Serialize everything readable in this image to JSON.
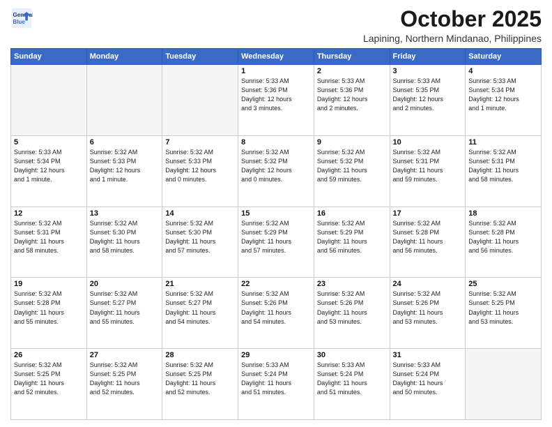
{
  "header": {
    "logo_line1": "General",
    "logo_line2": "Blue",
    "month": "October 2025",
    "location": "Lapining, Northern Mindanao, Philippines"
  },
  "weekdays": [
    "Sunday",
    "Monday",
    "Tuesday",
    "Wednesday",
    "Thursday",
    "Friday",
    "Saturday"
  ],
  "weeks": [
    [
      {
        "day": "",
        "empty": true
      },
      {
        "day": "",
        "empty": true
      },
      {
        "day": "",
        "empty": true
      },
      {
        "day": "1",
        "info": "Sunrise: 5:33 AM\nSunset: 5:36 PM\nDaylight: 12 hours\nand 3 minutes."
      },
      {
        "day": "2",
        "info": "Sunrise: 5:33 AM\nSunset: 5:36 PM\nDaylight: 12 hours\nand 2 minutes."
      },
      {
        "day": "3",
        "info": "Sunrise: 5:33 AM\nSunset: 5:35 PM\nDaylight: 12 hours\nand 2 minutes."
      },
      {
        "day": "4",
        "info": "Sunrise: 5:33 AM\nSunset: 5:34 PM\nDaylight: 12 hours\nand 1 minute."
      }
    ],
    [
      {
        "day": "5",
        "info": "Sunrise: 5:33 AM\nSunset: 5:34 PM\nDaylight: 12 hours\nand 1 minute."
      },
      {
        "day": "6",
        "info": "Sunrise: 5:32 AM\nSunset: 5:33 PM\nDaylight: 12 hours\nand 1 minute."
      },
      {
        "day": "7",
        "info": "Sunrise: 5:32 AM\nSunset: 5:33 PM\nDaylight: 12 hours\nand 0 minutes."
      },
      {
        "day": "8",
        "info": "Sunrise: 5:32 AM\nSunset: 5:32 PM\nDaylight: 12 hours\nand 0 minutes."
      },
      {
        "day": "9",
        "info": "Sunrise: 5:32 AM\nSunset: 5:32 PM\nDaylight: 11 hours\nand 59 minutes."
      },
      {
        "day": "10",
        "info": "Sunrise: 5:32 AM\nSunset: 5:31 PM\nDaylight: 11 hours\nand 59 minutes."
      },
      {
        "day": "11",
        "info": "Sunrise: 5:32 AM\nSunset: 5:31 PM\nDaylight: 11 hours\nand 58 minutes."
      }
    ],
    [
      {
        "day": "12",
        "info": "Sunrise: 5:32 AM\nSunset: 5:31 PM\nDaylight: 11 hours\nand 58 minutes."
      },
      {
        "day": "13",
        "info": "Sunrise: 5:32 AM\nSunset: 5:30 PM\nDaylight: 11 hours\nand 58 minutes."
      },
      {
        "day": "14",
        "info": "Sunrise: 5:32 AM\nSunset: 5:30 PM\nDaylight: 11 hours\nand 57 minutes."
      },
      {
        "day": "15",
        "info": "Sunrise: 5:32 AM\nSunset: 5:29 PM\nDaylight: 11 hours\nand 57 minutes."
      },
      {
        "day": "16",
        "info": "Sunrise: 5:32 AM\nSunset: 5:29 PM\nDaylight: 11 hours\nand 56 minutes."
      },
      {
        "day": "17",
        "info": "Sunrise: 5:32 AM\nSunset: 5:28 PM\nDaylight: 11 hours\nand 56 minutes."
      },
      {
        "day": "18",
        "info": "Sunrise: 5:32 AM\nSunset: 5:28 PM\nDaylight: 11 hours\nand 56 minutes."
      }
    ],
    [
      {
        "day": "19",
        "info": "Sunrise: 5:32 AM\nSunset: 5:28 PM\nDaylight: 11 hours\nand 55 minutes."
      },
      {
        "day": "20",
        "info": "Sunrise: 5:32 AM\nSunset: 5:27 PM\nDaylight: 11 hours\nand 55 minutes."
      },
      {
        "day": "21",
        "info": "Sunrise: 5:32 AM\nSunset: 5:27 PM\nDaylight: 11 hours\nand 54 minutes."
      },
      {
        "day": "22",
        "info": "Sunrise: 5:32 AM\nSunset: 5:26 PM\nDaylight: 11 hours\nand 54 minutes."
      },
      {
        "day": "23",
        "info": "Sunrise: 5:32 AM\nSunset: 5:26 PM\nDaylight: 11 hours\nand 53 minutes."
      },
      {
        "day": "24",
        "info": "Sunrise: 5:32 AM\nSunset: 5:26 PM\nDaylight: 11 hours\nand 53 minutes."
      },
      {
        "day": "25",
        "info": "Sunrise: 5:32 AM\nSunset: 5:25 PM\nDaylight: 11 hours\nand 53 minutes."
      }
    ],
    [
      {
        "day": "26",
        "info": "Sunrise: 5:32 AM\nSunset: 5:25 PM\nDaylight: 11 hours\nand 52 minutes."
      },
      {
        "day": "27",
        "info": "Sunrise: 5:32 AM\nSunset: 5:25 PM\nDaylight: 11 hours\nand 52 minutes."
      },
      {
        "day": "28",
        "info": "Sunrise: 5:32 AM\nSunset: 5:25 PM\nDaylight: 11 hours\nand 52 minutes."
      },
      {
        "day": "29",
        "info": "Sunrise: 5:33 AM\nSunset: 5:24 PM\nDaylight: 11 hours\nand 51 minutes."
      },
      {
        "day": "30",
        "info": "Sunrise: 5:33 AM\nSunset: 5:24 PM\nDaylight: 11 hours\nand 51 minutes."
      },
      {
        "day": "31",
        "info": "Sunrise: 5:33 AM\nSunset: 5:24 PM\nDaylight: 11 hours\nand 50 minutes."
      },
      {
        "day": "",
        "empty": true
      }
    ]
  ]
}
